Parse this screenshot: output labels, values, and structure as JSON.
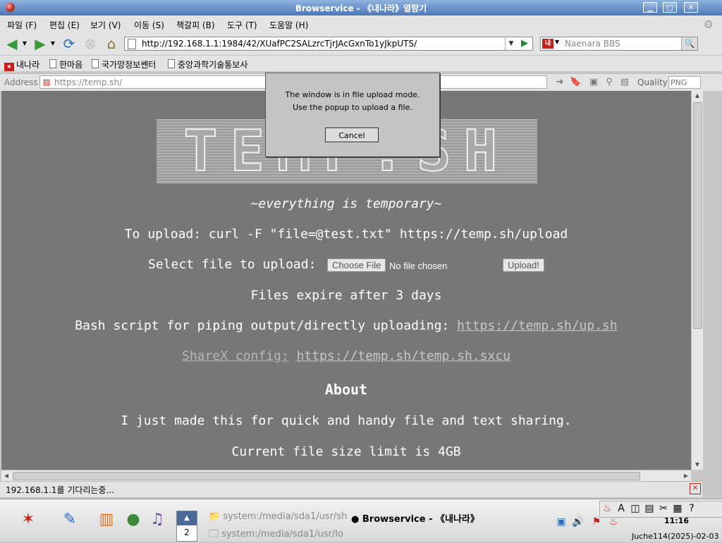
{
  "window": {
    "title": "Browservice - 《내나라》열람기",
    "min_label": "▁",
    "max_label": "□",
    "close_label": "✕"
  },
  "menu": [
    "파일 (F)",
    "편집 (E)",
    "보기 (V)",
    "이동 (S)",
    "책갈피 (B)",
    "도구 (T)",
    "도움말 (H)"
  ],
  "nav": {
    "url": "http://192.168.1.1:1984/42/XUafPC2SALzrcTjrJAcGxnTo1yJkpUTS/",
    "search_placeholder": "Naenara BBS",
    "search_engine_label": "내"
  },
  "bookmarks": [
    {
      "label": "내나라",
      "type": "star"
    },
    {
      "label": "한마음",
      "type": "page"
    },
    {
      "label": "국가망정보쎈터",
      "type": "page"
    },
    {
      "label": "중앙과학기술통보사",
      "type": "page"
    }
  ],
  "addressbar": {
    "label": "Address",
    "value": "https://temp.sh/",
    "quality_label": "Quality",
    "quality_value": "PNG"
  },
  "page": {
    "logo_text": "TEMP.SH",
    "tagline": "~everything is temporary~",
    "upload_cmd": "To upload: curl -F \"file=@test.txt\" https://temp.sh/upload",
    "select_label": "Select file to upload:",
    "choose_file": "Choose File",
    "no_file": "No file chosen",
    "upload_btn": "Upload!",
    "expire": "Files expire after 3 days",
    "bash_text": "Bash script for piping output/directly uploading:",
    "bash_link": "https://temp.sh/up.sh",
    "sharex_label": "ShareX config:",
    "sharex_link": "https://temp.sh/temp.sh.sxcu",
    "about_heading": "About",
    "about_text": "I just made this for quick and handy file and text sharing.",
    "size_limit": "Current file size limit is 4GB"
  },
  "modal": {
    "line1": "The window is in file upload mode.",
    "line2": "Use the popup to upload a file.",
    "cancel": "Cancel"
  },
  "status": "192.168.1.1를 기다리는중...",
  "taskbar": {
    "pager_num": "2",
    "task1": "system:/media/sda1/usr/sh",
    "task2": "system:/media/sda1/usr/lo",
    "task3": "Browservice - 《내나라》",
    "clock": "11:16",
    "date": "Juche114(2025)-02-03"
  }
}
